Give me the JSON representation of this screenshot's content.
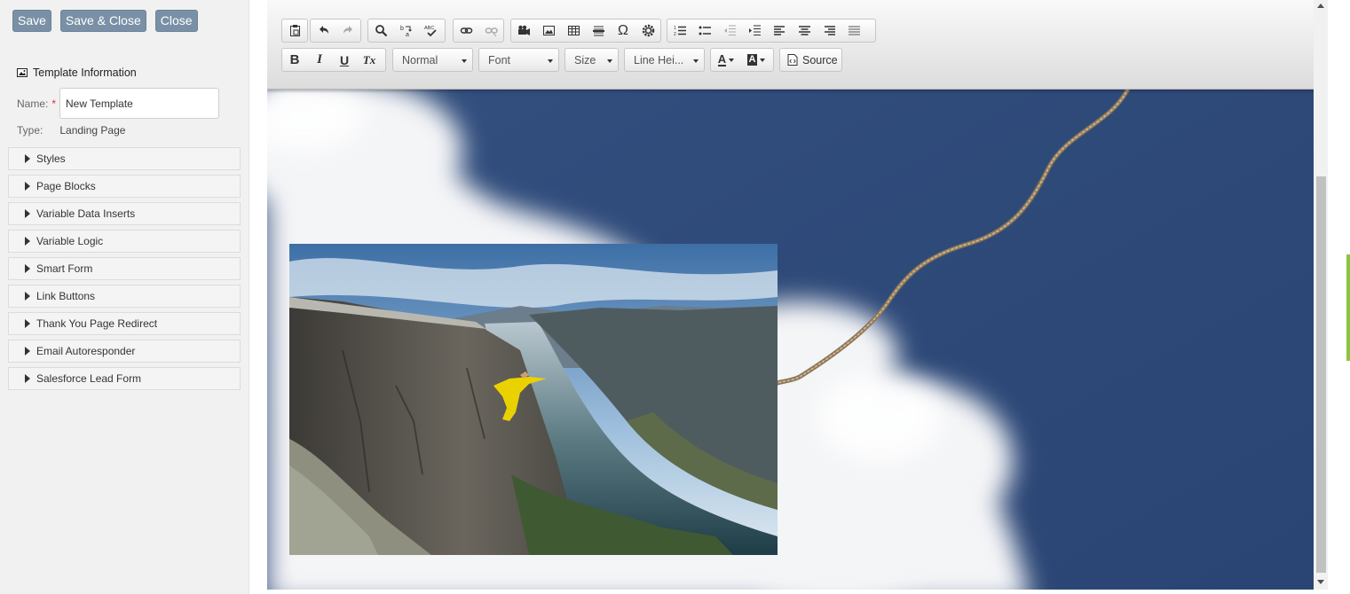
{
  "actions": {
    "save": "Save",
    "save_close": "Save & Close",
    "close": "Close"
  },
  "template": {
    "section_title": "Template Information",
    "name_label": "Name:",
    "required_mark": "*",
    "name_value": "New Template",
    "type_label": "Type:",
    "type_value": "Landing Page"
  },
  "accordion": [
    "Styles",
    "Page Blocks",
    "Variable Data Inserts",
    "Variable Logic",
    "Smart Form",
    "Link Buttons",
    "Thank You Page Redirect",
    "Email Autoresponder",
    "Salesforce Lead Form"
  ],
  "toolbar": {
    "bold": "B",
    "italic": "I",
    "underline": "U",
    "remove_format": "Tx",
    "special_char": "Ω",
    "format_combo": "Normal",
    "font_combo": "Font",
    "size_combo": "Size",
    "line_height_combo": "Line Hei...",
    "text_color": "A",
    "bg_color": "A",
    "source": "Source"
  },
  "icons": {
    "top_row": [
      "paste-icon",
      "undo-icon",
      "redo-icon",
      "find-icon",
      "replace-icon",
      "spellcheck-icon",
      "link-icon",
      "unlink-icon",
      "video-icon",
      "image-icon",
      "table-icon",
      "horizontal-rule-icon",
      "special-char-icon",
      "settings-icon",
      "numbered-list-icon",
      "bullet-list-icon",
      "outdent-icon",
      "indent-icon",
      "align-left-icon",
      "align-center-icon",
      "align-right-icon",
      "justify-icon"
    ]
  },
  "colors": {
    "sky": "#2f4a7c",
    "button": "#7990a6",
    "scroll_accent": "#8cc63f"
  }
}
